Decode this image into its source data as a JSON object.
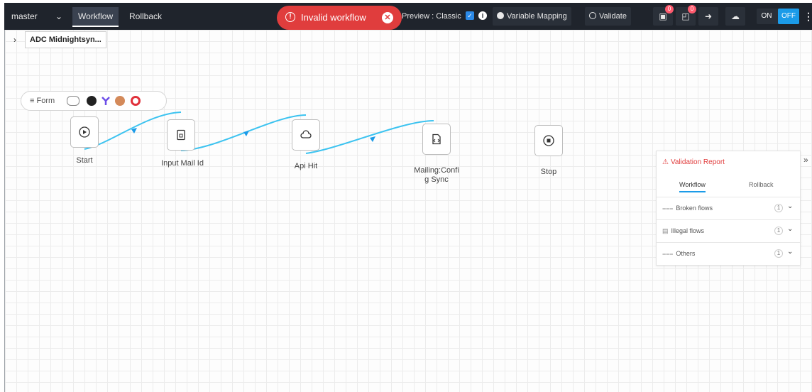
{
  "topbar": {
    "branch": "master",
    "tabs": [
      {
        "label": "Workflow",
        "active": true
      },
      {
        "label": "Rollback",
        "active": false
      }
    ],
    "error_pill": "Invalid workflow",
    "preview_label": "Preview : Classic",
    "preview_checked": true,
    "variable_mapping": "Variable Mapping",
    "validate": "Validate",
    "notif_badge_1": "0",
    "notif_badge_2": "0",
    "toggle_on": "ON",
    "toggle_off": "OFF"
  },
  "breadcrumb": {
    "title": "ADC Midnightsyn..."
  },
  "palette": {
    "label": "Form"
  },
  "nodes": [
    {
      "label": "Start",
      "icon": "play-circle-icon"
    },
    {
      "label": "Input Mail Id",
      "icon": "document-icon"
    },
    {
      "label": "Api Hit",
      "icon": "cloud-api-icon"
    },
    {
      "label_line1": "Mailing:Confi",
      "label_line2": "g Sync",
      "icon": "code-file-icon"
    },
    {
      "label": "Stop",
      "icon": "stop-circle-icon"
    }
  ],
  "validation": {
    "title": "Validation Report",
    "tabs": [
      "Workflow",
      "Rollback"
    ],
    "rows": [
      {
        "label": "Broken flows",
        "count": "1"
      },
      {
        "label": "Illegal flows",
        "count": "1"
      },
      {
        "label": "Others",
        "count": "1"
      }
    ]
  },
  "colors": {
    "topbar_bg": "#1f242c",
    "error": "#e03d3d",
    "connector": "#3cc3f0",
    "toggle_off": "#1b9be8"
  }
}
